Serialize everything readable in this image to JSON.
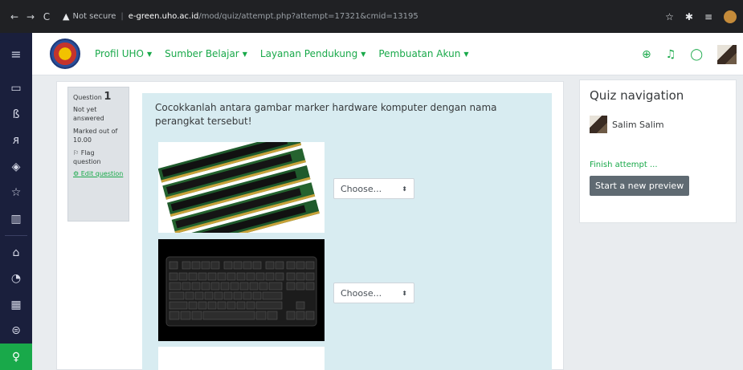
{
  "browser": {
    "back_icon": "←",
    "forward_icon": "→",
    "reload_icon": "C",
    "warning_icon": "▲",
    "not_secure": "Not secure",
    "host": "e-green.uho.ac.id",
    "path": "/mod/quiz/attempt.php?attempt=17321&cmid=13195",
    "icons": [
      "☆",
      "✱",
      "≡"
    ]
  },
  "navbar": {
    "hamburger_icon": "≡",
    "menu": [
      {
        "label": "Profil UHO"
      },
      {
        "label": "Sumber Belajar"
      },
      {
        "label": "Layanan Pendukung"
      },
      {
        "label": "Pembuatan Akun"
      }
    ],
    "caret": "▼",
    "icons": {
      "globe": "⊕",
      "bell": "♫",
      "chat": "◯"
    }
  },
  "sidebar": {
    "icons": [
      "▭",
      "ß",
      "ᴙ",
      "◈",
      "☆",
      "▥",
      "⌂",
      "◔",
      "▦",
      "⊜",
      "♀"
    ]
  },
  "question_info": {
    "prefix": "Question",
    "number": "1",
    "status": "Not yet answered",
    "marked": "Marked out of 10.00",
    "flag_icon": "⚐",
    "flag": "Flag question",
    "edit_icon": "⚙",
    "edit": "Edit question"
  },
  "question": {
    "text": "Cocokkanlah antara gambar marker hardware komputer dengan nama perangkat tersebut!",
    "selects": [
      {
        "value": "Choose..."
      },
      {
        "value": "Choose..."
      }
    ],
    "select_arrows": "⬍"
  },
  "quiz_nav": {
    "title": "Quiz navigation",
    "user_name": "Salim Salim",
    "finish_link": "Finish attempt ...",
    "new_preview_button": "Start a new preview"
  }
}
